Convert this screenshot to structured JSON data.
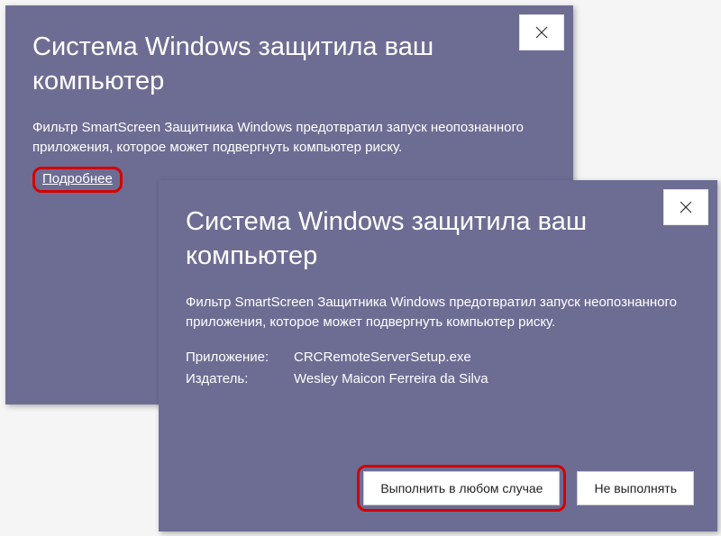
{
  "dialog1": {
    "title": "Система Windows защитила ваш компьютер",
    "body": "Фильтр SmartScreen Защитника Windows предотвратил запуск неопознанного приложения, которое может подвергнуть компьютер риску.",
    "more_link": "Подробнее"
  },
  "dialog2": {
    "title": "Система Windows защитила ваш компьютер",
    "body": "Фильтр SmartScreen Защитника Windows предотвратил запуск неопознанного приложения, которое может подвергнуть компьютер риску.",
    "app_label": "Приложение:",
    "app_value": "CRCRemoteServerSetup.exe",
    "publisher_label": "Издатель:",
    "publisher_value": "Wesley Maicon Ferreira da Silva",
    "run_anyway": "Выполнить в любом случае",
    "dont_run": "Не выполнять"
  }
}
